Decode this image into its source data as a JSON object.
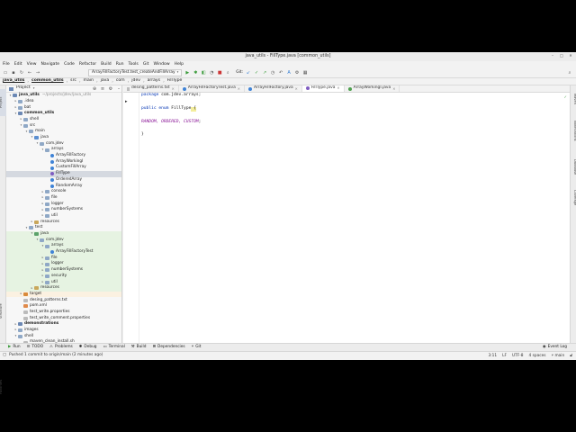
{
  "window": {
    "title": "java_utils - FillType.java [common_utils]"
  },
  "menu": [
    "File",
    "Edit",
    "View",
    "Navigate",
    "Code",
    "Refactor",
    "Build",
    "Run",
    "Tools",
    "Git",
    "Window",
    "Help"
  ],
  "toolbar": {
    "run_config": "ArrayFillFactoryTest.test_createAndFillArray",
    "git_label": "Git:"
  },
  "breadcrumb": [
    "java_utils",
    "common_utils",
    "src",
    "main",
    "java",
    "com",
    "jdev",
    "arrays",
    "FillType"
  ],
  "project_panel": {
    "title": "Project",
    "tree": [
      {
        "label": "java_utils",
        "extra": "~/projects/jdev/java_utils",
        "depth": 0,
        "arrow": "▾",
        "icon": "mod",
        "bold": true
      },
      {
        "label": ".idea",
        "depth": 1,
        "arrow": "▸",
        "icon": "folder"
      },
      {
        "label": "bat",
        "depth": 1,
        "arrow": "▸",
        "icon": "folder"
      },
      {
        "label": "common_utils",
        "depth": 1,
        "arrow": "▾",
        "icon": "mod",
        "bold": true
      },
      {
        "label": "shell",
        "depth": 2,
        "arrow": "▸",
        "icon": "folder"
      },
      {
        "label": "src",
        "depth": 2,
        "arrow": "▾",
        "icon": "folder"
      },
      {
        "label": "main",
        "depth": 3,
        "arrow": "▾",
        "icon": "folder"
      },
      {
        "label": "java",
        "depth": 4,
        "arrow": "▾",
        "icon": "src"
      },
      {
        "label": "com.jdev",
        "depth": 5,
        "arrow": "▾",
        "icon": "folder"
      },
      {
        "label": "arrays",
        "depth": 6,
        "arrow": "▾",
        "icon": "folder"
      },
      {
        "label": "ArrayFillFactory",
        "depth": 7,
        "arrow": "",
        "icon": "cls"
      },
      {
        "label": "ArrayWorkingI",
        "depth": 7,
        "arrow": "",
        "icon": "cls"
      },
      {
        "label": "CustomFillArray",
        "depth": 7,
        "arrow": "",
        "icon": "cls"
      },
      {
        "label": "FillType",
        "depth": 7,
        "arrow": "",
        "icon": "enum",
        "state": "sel"
      },
      {
        "label": "OrderedArray",
        "depth": 7,
        "arrow": "",
        "icon": "cls"
      },
      {
        "label": "RandomArray",
        "depth": 7,
        "arrow": "",
        "icon": "cls"
      },
      {
        "label": "console",
        "depth": 6,
        "arrow": "▸",
        "icon": "folder"
      },
      {
        "label": "file",
        "depth": 6,
        "arrow": "▸",
        "icon": "folder"
      },
      {
        "label": "logger",
        "depth": 6,
        "arrow": "▸",
        "icon": "folder"
      },
      {
        "label": "numberSystems",
        "depth": 6,
        "arrow": "▸",
        "icon": "folder"
      },
      {
        "label": "util",
        "depth": 6,
        "arrow": "▸",
        "icon": "folder"
      },
      {
        "label": "resources",
        "depth": 4,
        "arrow": "▸",
        "icon": "res"
      },
      {
        "label": "test",
        "depth": 3,
        "arrow": "▾",
        "icon": "folder"
      },
      {
        "label": "java",
        "depth": 4,
        "arrow": "▾",
        "icon": "test",
        "state": "green"
      },
      {
        "label": "com.jdev",
        "depth": 5,
        "arrow": "▾",
        "icon": "folder",
        "state": "green"
      },
      {
        "label": "arrays",
        "depth": 6,
        "arrow": "▾",
        "icon": "folder",
        "state": "green"
      },
      {
        "label": "ArrayFillFactoryTest",
        "depth": 7,
        "arrow": "",
        "icon": "cls",
        "state": "green"
      },
      {
        "label": "file",
        "depth": 6,
        "arrow": "▸",
        "icon": "folder",
        "state": "green"
      },
      {
        "label": "logger",
        "depth": 6,
        "arrow": "▸",
        "icon": "folder",
        "state": "green"
      },
      {
        "label": "numberSystems",
        "depth": 6,
        "arrow": "▸",
        "icon": "folder",
        "state": "green"
      },
      {
        "label": "security",
        "depth": 6,
        "arrow": "▸",
        "icon": "folder",
        "state": "green"
      },
      {
        "label": "util",
        "depth": 6,
        "arrow": "▸",
        "icon": "folder",
        "state": "green"
      },
      {
        "label": "resources",
        "depth": 4,
        "arrow": "▸",
        "icon": "res",
        "state": "green"
      },
      {
        "label": "target",
        "depth": 2,
        "arrow": "▸",
        "icon": "target",
        "state": "targ"
      },
      {
        "label": "desing_patterns.txt",
        "depth": 2,
        "arrow": "",
        "icon": "file"
      },
      {
        "label": "pom.xml",
        "depth": 2,
        "arrow": "",
        "icon": "xml"
      },
      {
        "label": "test_write.properties",
        "depth": 2,
        "arrow": "",
        "icon": "file"
      },
      {
        "label": "test_write_comment.properties",
        "depth": 2,
        "arrow": "",
        "icon": "file"
      },
      {
        "label": "demonstrations",
        "depth": 1,
        "arrow": "▸",
        "icon": "mod",
        "bold": true
      },
      {
        "label": "images",
        "depth": 1,
        "arrow": "▸",
        "icon": "folder"
      },
      {
        "label": "shell",
        "depth": 1,
        "arrow": "▾",
        "icon": "folder"
      },
      {
        "label": "maven_clean_install.sh",
        "depth": 2,
        "arrow": "",
        "icon": "file"
      }
    ]
  },
  "tabs": [
    {
      "label": "desing_patterns.txt",
      "active": false
    },
    {
      "label": "ArrayFillFactoryTest.java",
      "active": false
    },
    {
      "label": "ArrayFillFactory.java",
      "active": false
    },
    {
      "label": "FillType.java",
      "active": true
    },
    {
      "label": "ArrayWorkingI.java",
      "active": false
    }
  ],
  "code": {
    "package_kw": "package",
    "package_name": " com.jdev.arrays;",
    "public_kw": "public",
    "enum_kw": " enum",
    "enum_name": " FillType",
    "open_brace": " {",
    "constants": "RANDOM, ORDERED, CUSTOM",
    "semicolon": ";",
    "close_brace": "}"
  },
  "left_tabs": [
    "Project",
    "Structure",
    "Favorites"
  ],
  "right_tabs": [
    "Maven",
    "Notifications",
    "Database",
    "Coverage"
  ],
  "bottom_tabs": [
    "Run",
    "TODO",
    "Problems",
    "Debug",
    "Terminal",
    "Build",
    "Dependencies",
    "Git"
  ],
  "bottom_right": "Event Log",
  "status": {
    "message": "Pushed 1 commit to origin/main (2 minutes ago)",
    "position": "3:11",
    "line_sep": "LF",
    "encoding": "UTF-8",
    "indent": "4 spaces",
    "branch": "main"
  }
}
